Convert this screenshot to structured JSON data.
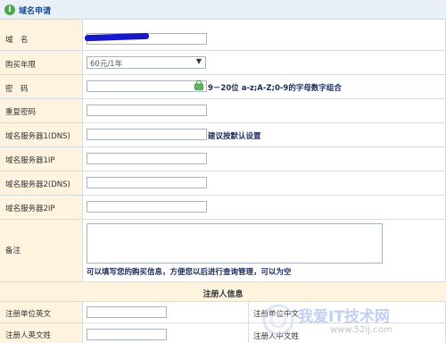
{
  "header": {
    "title": "域名申请",
    "icon": "info-icon"
  },
  "form": {
    "domain_label": "域　名",
    "years_label": "购买年限",
    "years_selected": "60元/1年",
    "password_label": "密　码",
    "password_hint": "9－20位 a-z;A-Z;0-9的字母数字组合",
    "confirm_label": "重复密码",
    "dns1_label": "域名服务器1(DNS)",
    "dns_hint": "建议按默认设置",
    "dns1ip_label": "域名服务器1IP",
    "dns2_label": "域名服务器2(DNS)",
    "dns2ip_label": "域名服务器2IP",
    "notes_label": "备注",
    "notes_hint": "可以填写您的购买信息，方便您以后进行查询管理，可以为空"
  },
  "registrant": {
    "section_title": "注册人信息",
    "org_en_label": "注册单位英文",
    "org_cn_label": "注册单位中文",
    "person_en_label": "注册人英文姓",
    "person_cn_label": "注册人中文姓"
  },
  "watermark": {
    "text": "我爱IT技术网",
    "url": "www.52ij.com"
  },
  "colors": {
    "label_bg": "#fdf3df",
    "title_text": "#1d4e8f",
    "border": "#d8dde4",
    "redaction": "#1818c8"
  }
}
